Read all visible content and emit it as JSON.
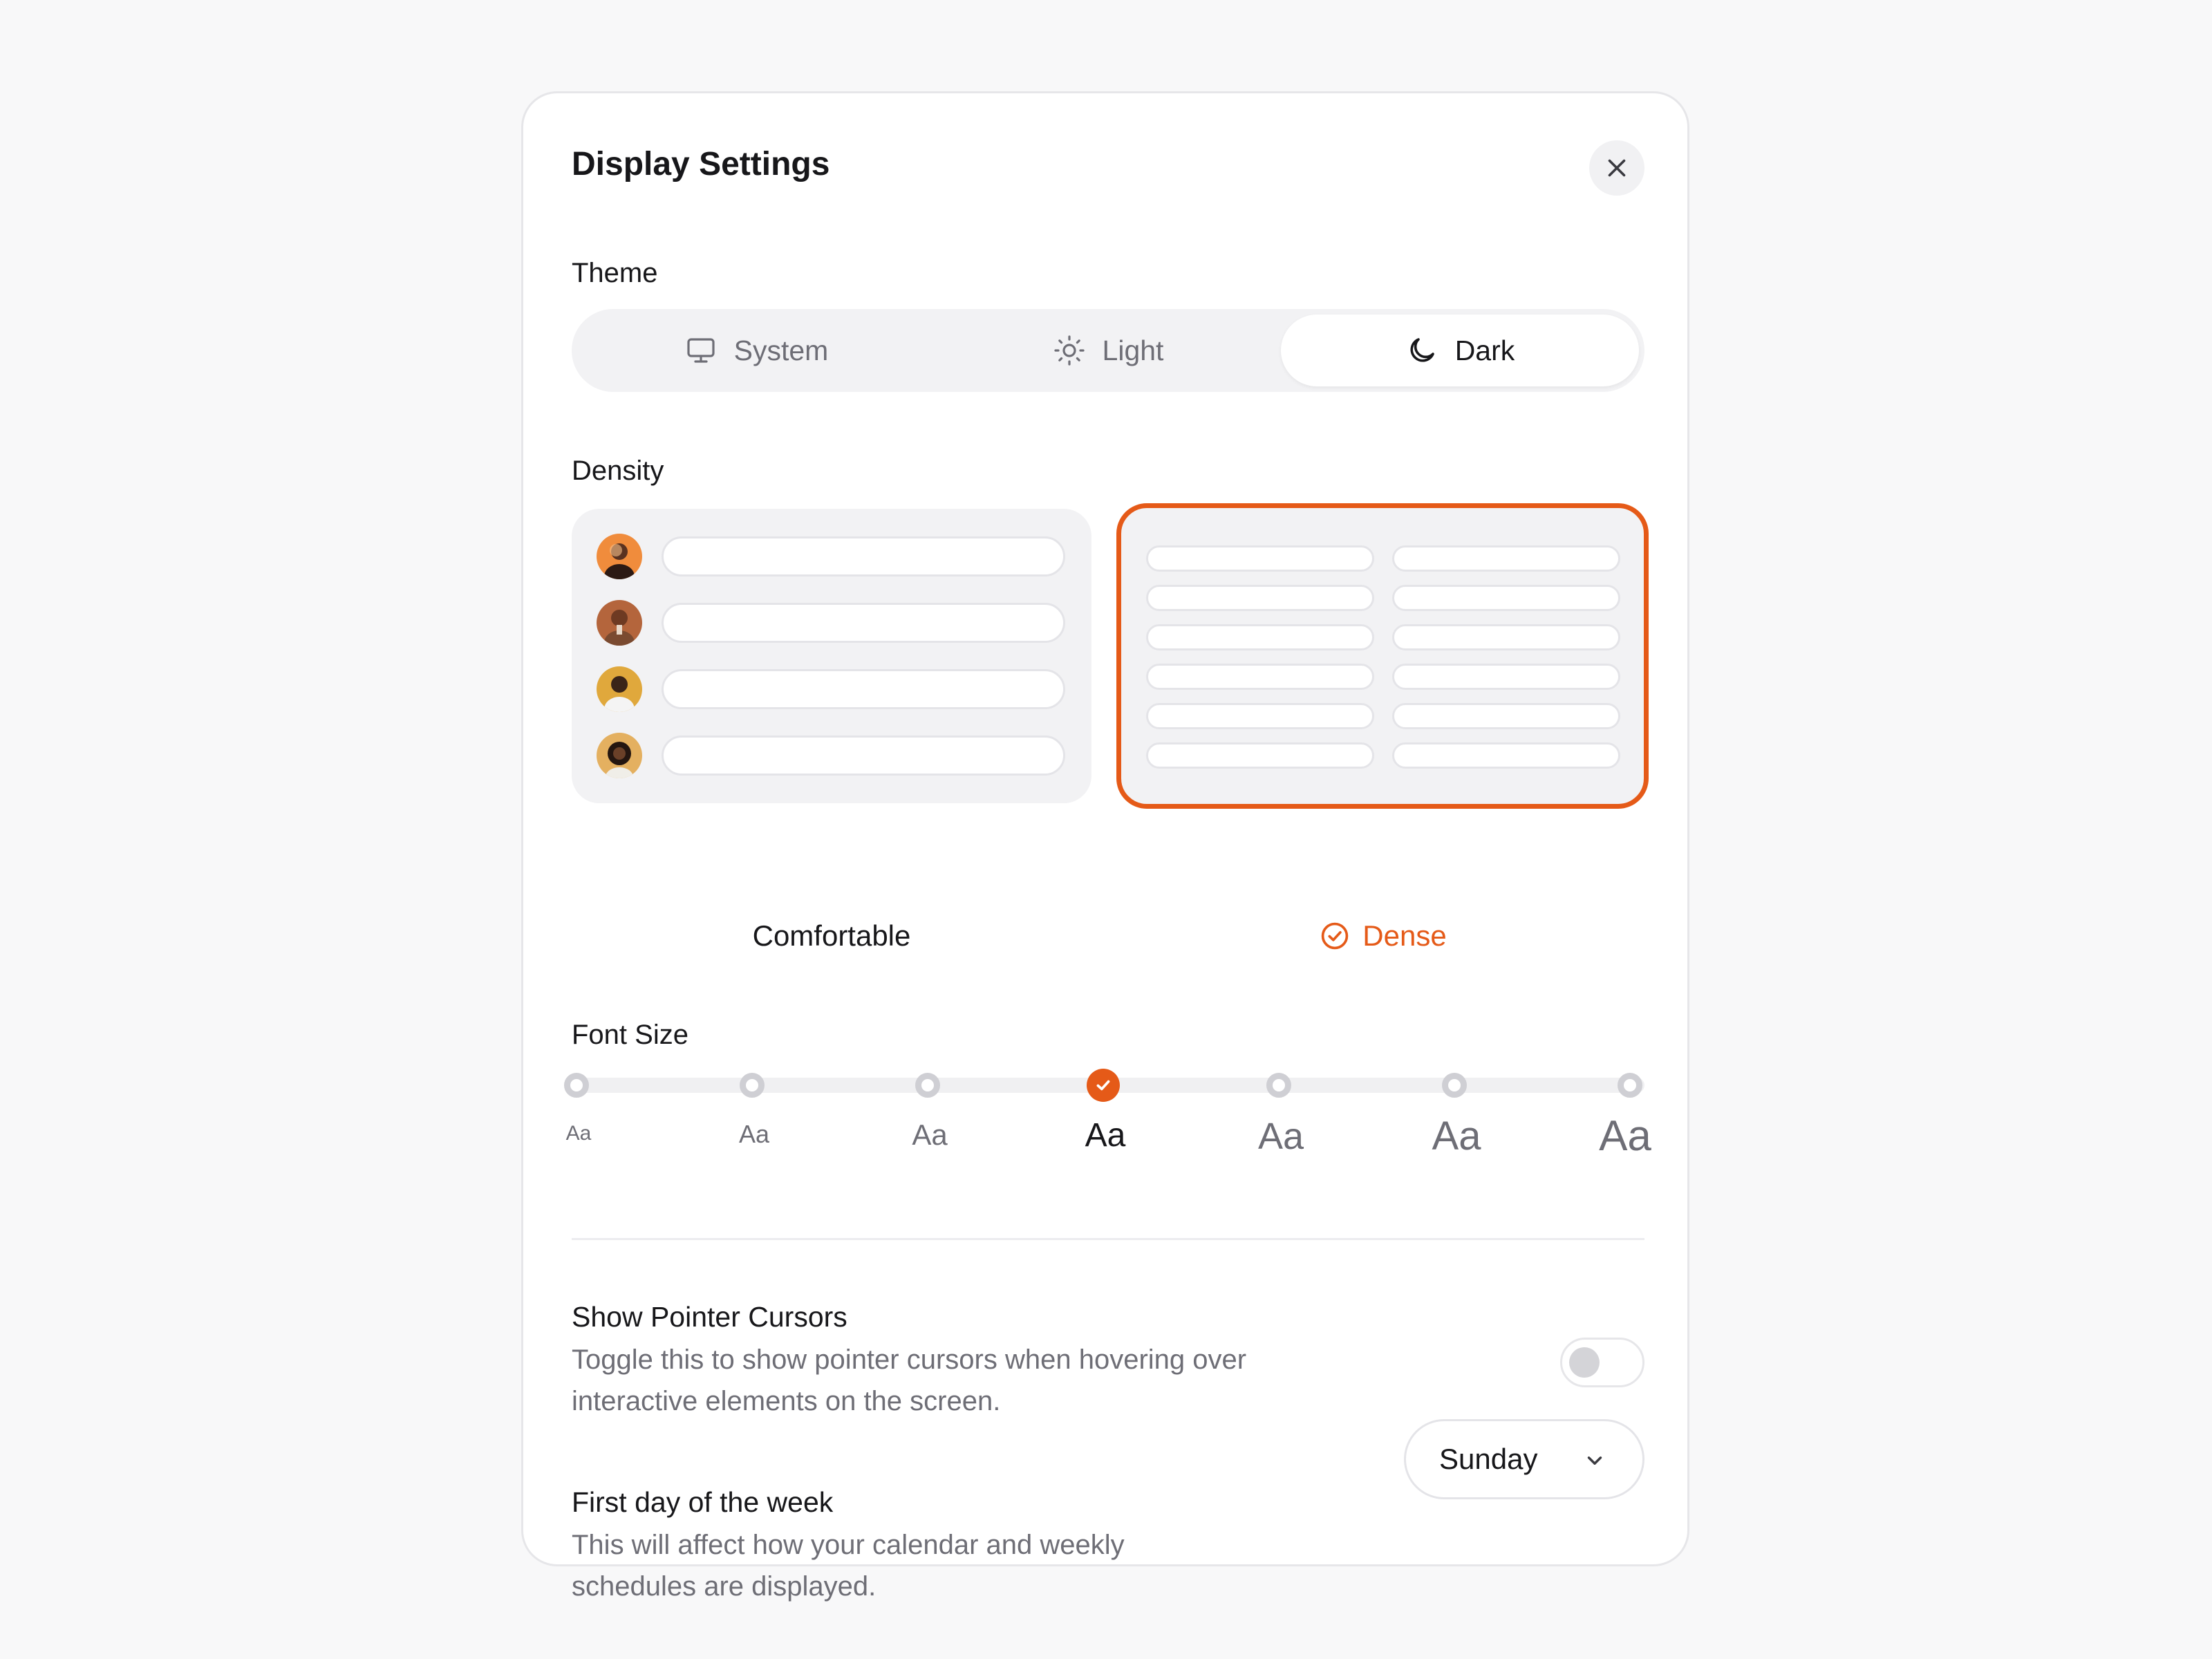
{
  "dialog": {
    "title": "Display Settings",
    "close_icon": "close-icon"
  },
  "theme": {
    "label": "Theme",
    "options": [
      {
        "label": "System",
        "icon": "monitor-icon",
        "selected": false
      },
      {
        "label": "Light",
        "icon": "sun-icon",
        "selected": false
      },
      {
        "label": "Dark",
        "icon": "moon-icon",
        "selected": true
      }
    ]
  },
  "density": {
    "label": "Density",
    "options": [
      {
        "label": "Comfortable",
        "selected": false
      },
      {
        "label": "Dense",
        "selected": true,
        "icon": "check-circle-icon"
      }
    ]
  },
  "font_size": {
    "label": "Font Size",
    "stops": [
      "Aa",
      "Aa",
      "Aa",
      "Aa",
      "Aa",
      "Aa",
      "Aa"
    ],
    "selected_index": 3
  },
  "pointer_cursors": {
    "title": "Show Pointer Cursors",
    "description": "Toggle this to show pointer cursors when hovering over interactive elements on the screen.",
    "enabled": false
  },
  "first_day": {
    "title": "First day of the week",
    "description": "This will affect how your calendar and weekly schedules are displayed.",
    "value": "Sunday"
  },
  "colors": {
    "accent": "#e55a18",
    "panel_background": "#ffffff",
    "page_background": "#f8f8f9",
    "muted_text": "#6e6e76"
  }
}
